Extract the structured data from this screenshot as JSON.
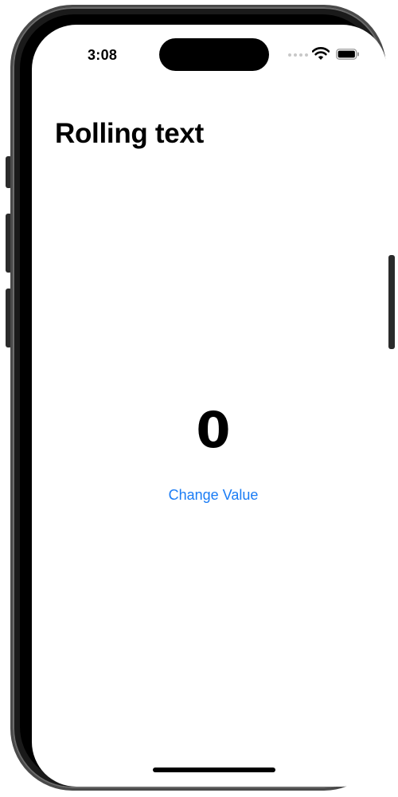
{
  "status_bar": {
    "time": "3:08",
    "icons": [
      "cellular-signal-icon",
      "wifi-icon",
      "battery-icon"
    ]
  },
  "navigation": {
    "title": "Rolling text"
  },
  "counter": {
    "value": "0"
  },
  "actions": {
    "change_value_label": "Change Value"
  },
  "colors": {
    "accent": "#1a7cf5",
    "text": "#000000",
    "background": "#ffffff"
  }
}
